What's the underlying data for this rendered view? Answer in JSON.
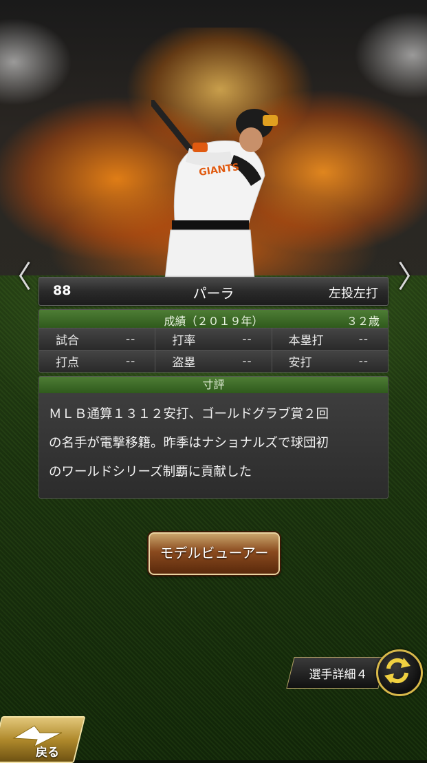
{
  "player": {
    "number": "88",
    "name": "パーラ",
    "handedness": "左投左打"
  },
  "stats": {
    "title": "成績（２０１９年）",
    "age": "３２歳",
    "rows": [
      [
        {
          "label": "試合",
          "value": "--"
        },
        {
          "label": "打率",
          "value": "--"
        },
        {
          "label": "本塁打",
          "value": "--"
        }
      ],
      [
        {
          "label": "打点",
          "value": "--"
        },
        {
          "label": "盗塁",
          "value": "--"
        },
        {
          "label": "安打",
          "value": "--"
        }
      ]
    ]
  },
  "review": {
    "title": "寸評",
    "lines": [
      "ＭＬＢ通算１３１２安打、ゴールドグラブ賞２回",
      "の名手が電撃移籍。昨季はナショナルズで球団初",
      "のワールドシリーズ制覇に貢献した"
    ]
  },
  "buttons": {
    "model_viewer": "モデルビューアー",
    "player_detail": "選手詳細４",
    "back": "戻る"
  },
  "nav": {
    "prev": "〈",
    "next": "〉"
  },
  "icons": {
    "prev": "chevron-left-icon",
    "next": "chevron-right-icon",
    "cycle": "cycle-arrows-icon",
    "back": "back-arrow-icon"
  },
  "colors": {
    "section_header": "#3f6b28",
    "button_brown": "#8a4a1e",
    "gold_border": "#d8b84a"
  }
}
